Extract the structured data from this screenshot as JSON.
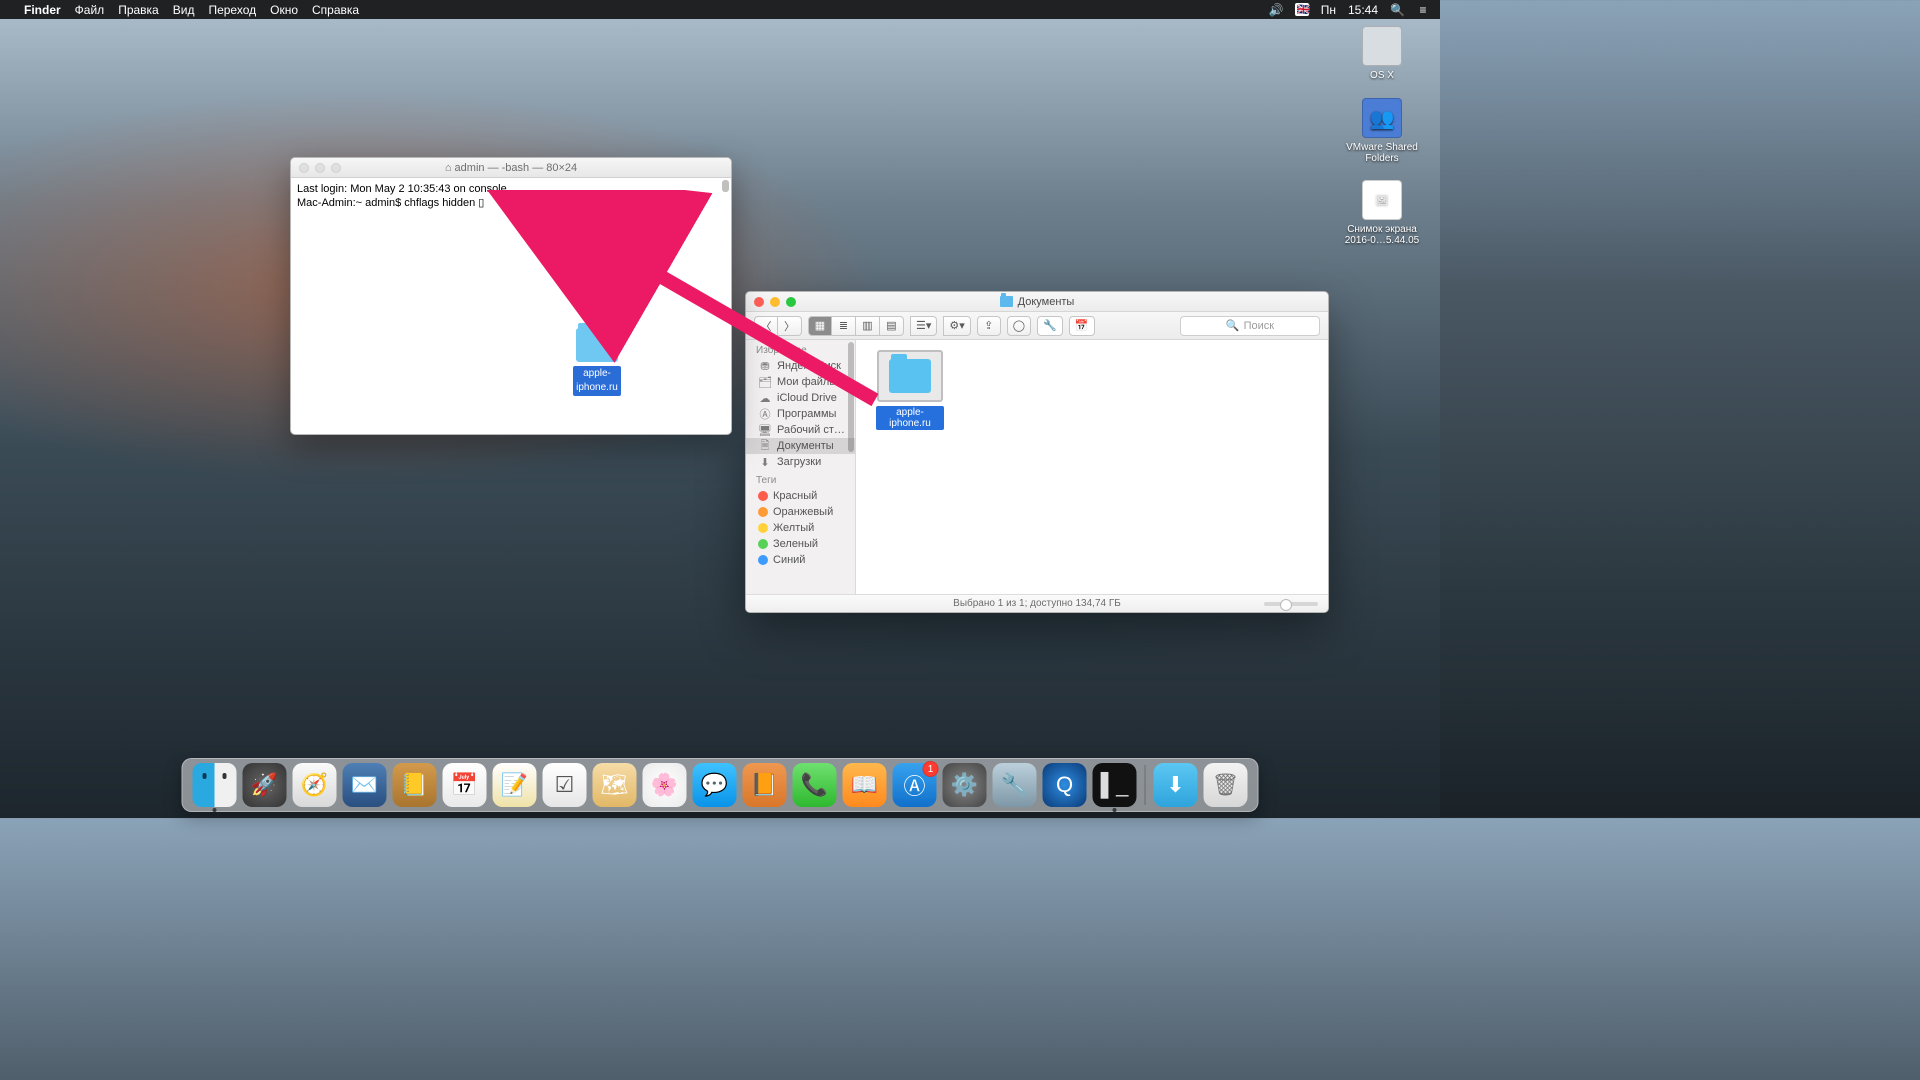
{
  "menubar": {
    "app": "Finder",
    "items": [
      "Файл",
      "Правка",
      "Вид",
      "Переход",
      "Окно",
      "Справка"
    ],
    "right": {
      "lang": "英",
      "lang_code": "EN",
      "flag": "🇬🇧",
      "day": "Пн",
      "time": "15:44"
    }
  },
  "desktop": {
    "osx": "OS X",
    "vmware": "VMware Shared Folders",
    "screenshot": "Снимок экрана 2016-0…5.44.05"
  },
  "terminal": {
    "title": "admin — -bash — 80×24",
    "line1": "Last login: Mon May  2 10:35:43 on console",
    "line2": "Mac-Admin:~ admin$ chflags hidden ▯",
    "folder_label": "apple-iphone.ru"
  },
  "finder": {
    "title": "Документы",
    "search_placeholder": "Поиск",
    "sidebar": {
      "fav_header": "Избранное",
      "items": [
        "Яндекс.Диск",
        "Мои файлы",
        "iCloud Drive",
        "Программы",
        "Рабочий ст…",
        "Документы",
        "Загрузки"
      ],
      "tags_header": "Теги",
      "tags": [
        {
          "name": "Красный",
          "color": "#ff5b4d"
        },
        {
          "name": "Оранжевый",
          "color": "#ff9a36"
        },
        {
          "name": "Желтый",
          "color": "#ffd23b"
        },
        {
          "name": "Зеленый",
          "color": "#57d159"
        },
        {
          "name": "Синий",
          "color": "#3d9bff"
        }
      ]
    },
    "file_label": "apple-iphone.ru",
    "status": "Выбрано 1 из 1; доступно 134,74 ГБ"
  },
  "dock": {
    "appstore_badge": "1"
  }
}
